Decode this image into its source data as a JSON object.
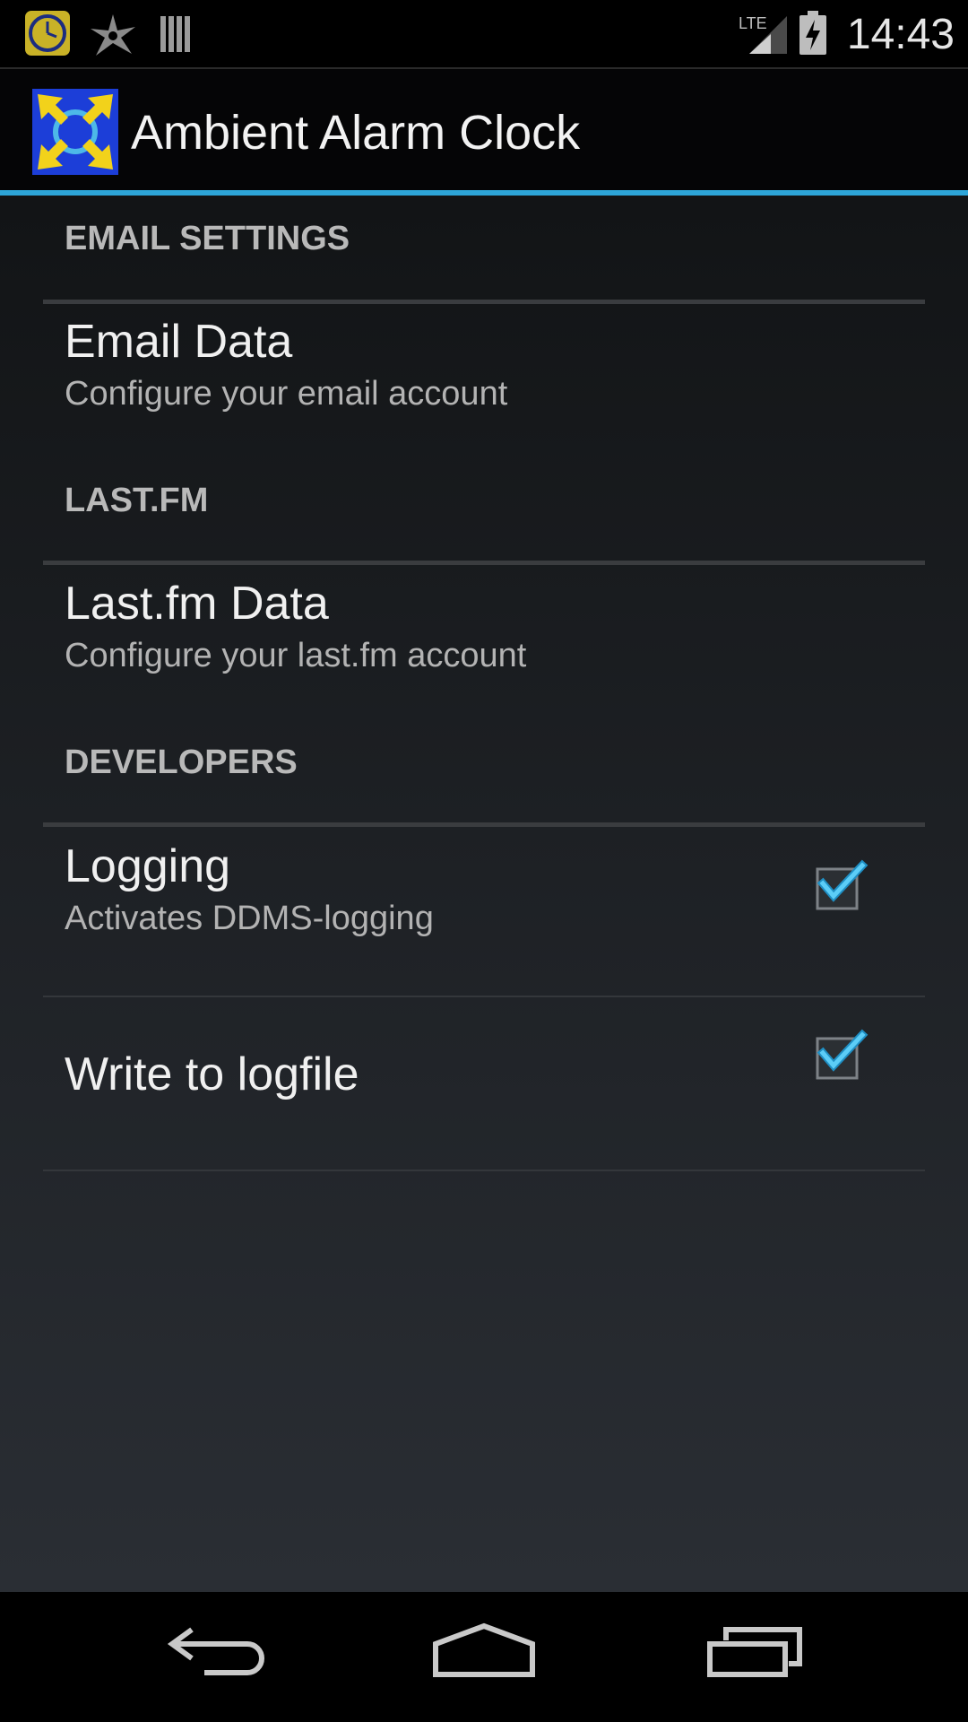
{
  "status_bar": {
    "time": "14:43",
    "network_label": "LTE",
    "icons": [
      "clock-icon",
      "star-icon",
      "barcode-icon",
      "signal-icon",
      "battery-charging-icon"
    ]
  },
  "action_bar": {
    "title": "Ambient Alarm Clock",
    "accent_color": "#2da5d8",
    "app_icon": "ambient-alarm-clock-app-icon"
  },
  "preferences": {
    "email_category": {
      "title": "EMAIL SETTINGS"
    },
    "email_data": {
      "title": "Email Data",
      "summary": "Configure your email account"
    },
    "lastfm_category": {
      "title": "LAST.FM"
    },
    "lastfm_data": {
      "title": "Last.fm Data",
      "summary": "Configure your last.fm account"
    },
    "developers_category": {
      "title": "DEVELOPERS"
    },
    "logging": {
      "title": "Logging",
      "summary": "Activates DDMS-logging",
      "checked": true
    },
    "write_logfile": {
      "title": "Write to logfile",
      "checked": true
    }
  },
  "nav_bar": {
    "icons": [
      "back-icon",
      "home-icon",
      "recents-icon"
    ]
  }
}
